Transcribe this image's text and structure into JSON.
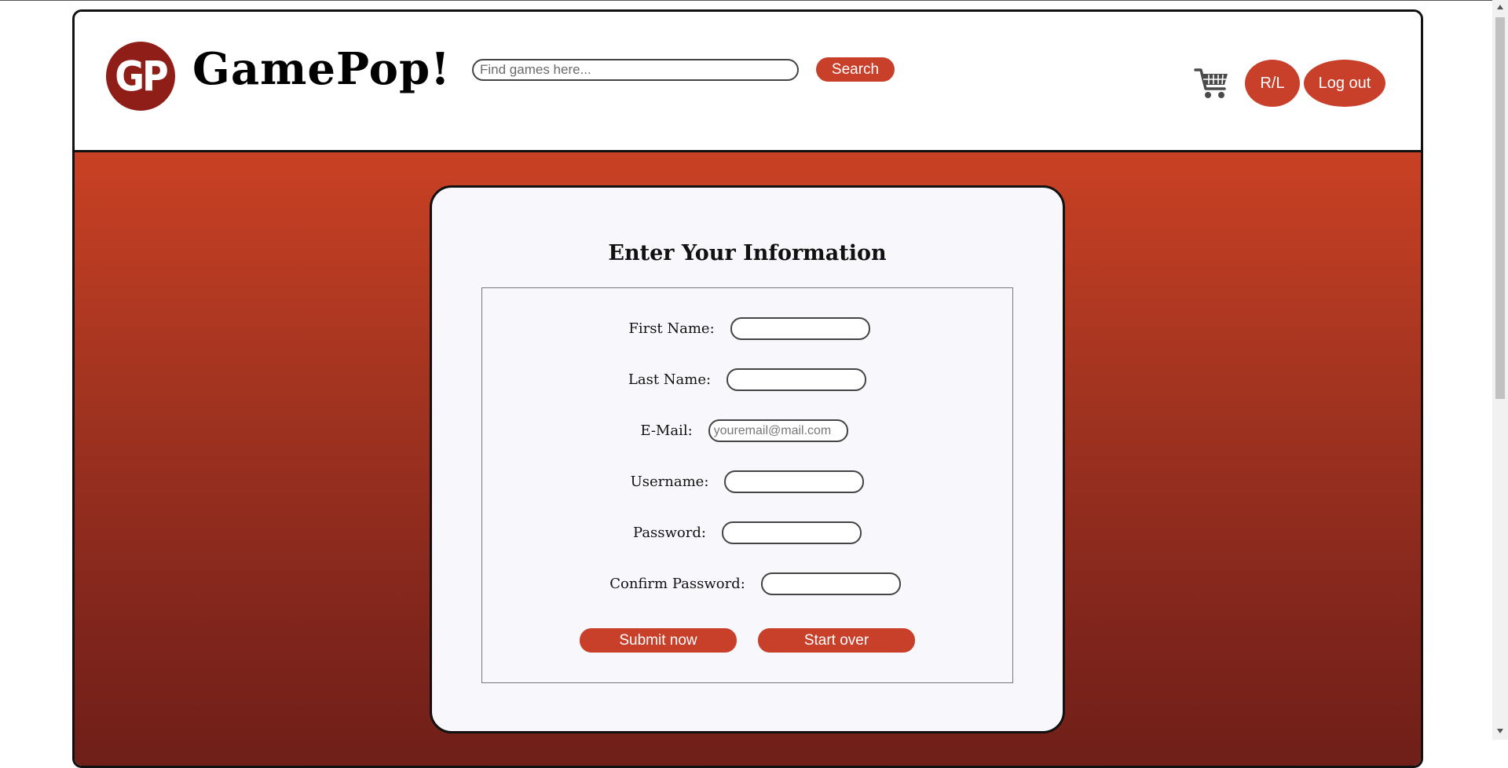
{
  "header": {
    "logo_text": "GP",
    "brand": "GamePop!",
    "search": {
      "placeholder": "Find games here...",
      "button_label": "Search"
    },
    "rl_label": "R/L",
    "logout_label": "Log out"
  },
  "form": {
    "title": "Enter Your Information",
    "fields": {
      "first_name": {
        "label": "First Name:"
      },
      "last_name": {
        "label": "Last Name:"
      },
      "email": {
        "label": "E-Mail:",
        "placeholder": "youremail@mail.com"
      },
      "username": {
        "label": "Username:"
      },
      "password": {
        "label": "Password:"
      },
      "confirm_password": {
        "label": "Confirm Password:"
      }
    },
    "submit_label": "Submit now",
    "reset_label": "Start over"
  },
  "colors": {
    "accent": "#c8402a",
    "logo": "#8f1e18",
    "gradient_top": "#c94124",
    "gradient_bottom": "#6e1f18",
    "card_bg": "#f7f7fc"
  },
  "icons": {
    "cart": "shopping-cart-icon"
  }
}
